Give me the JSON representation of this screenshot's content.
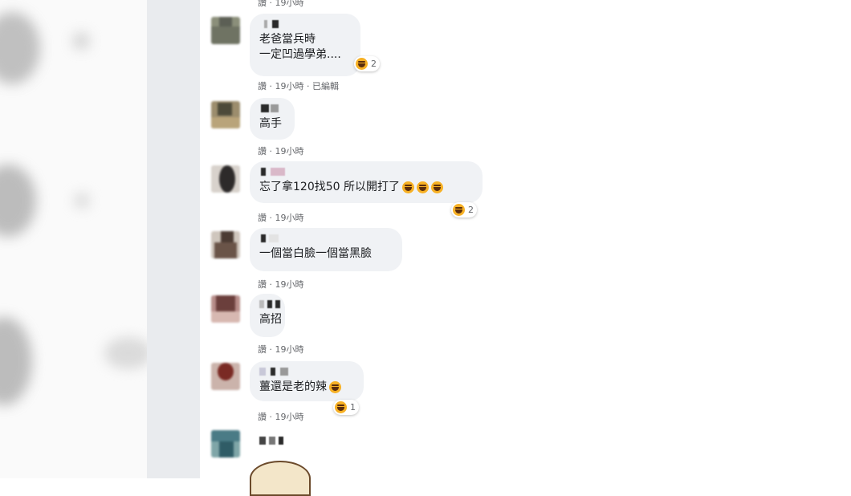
{
  "top_meta": "讚 · 19小時",
  "comments": [
    {
      "text": "老爸當兵時\n一定凹過學弟....",
      "reaction_count": "2",
      "meta": "讚 · 19小時 · 已編輯"
    },
    {
      "text": "高手",
      "meta": "讚 · 19小時"
    },
    {
      "text": "忘了拿120找50 所以開打了",
      "reaction_count": "2",
      "meta": "讚 · 19小時"
    },
    {
      "text": "一個當白臉一個當黑臉",
      "meta": "讚 · 19小時"
    },
    {
      "text": "高招",
      "meta": "讚 · 19小時"
    },
    {
      "text": "薑還是老的辣",
      "reaction_count": "1",
      "meta": "讚 · 19小時"
    }
  ],
  "icons": {
    "reaction": "laugh-emoji-icon"
  },
  "colors": {
    "bubble": "#f0f2f5",
    "meta": "#65676b",
    "frame": "#e9ebee",
    "emoji": "#f7b125"
  }
}
